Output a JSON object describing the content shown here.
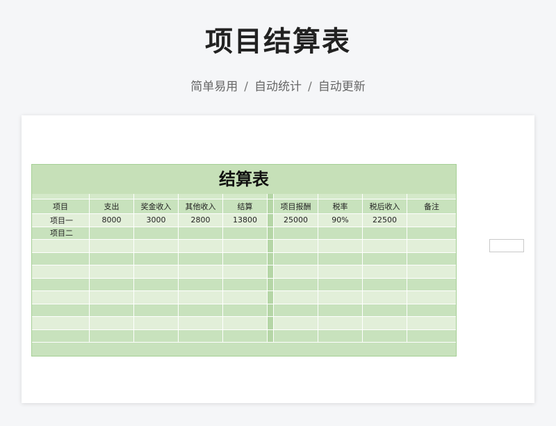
{
  "header": {
    "title": "项目结算表",
    "subtitle_parts": [
      "简单易用",
      "自动统计",
      "自动更新"
    ],
    "separator": "/"
  },
  "sheet": {
    "table_title": "结算表",
    "columns": [
      "项目",
      "支出",
      "奖金收入",
      "其他收入",
      "结算",
      "项目报酬",
      "税率",
      "税后收入",
      "备注"
    ],
    "rows": [
      [
        "项目一",
        "8000",
        "3000",
        "2800",
        "13800",
        "25000",
        "90%",
        "22500",
        ""
      ],
      [
        "项目二",
        "",
        "",
        "",
        "",
        "",
        "",
        "",
        ""
      ],
      [
        "",
        "",
        "",
        "",
        "",
        "",
        "",
        "",
        ""
      ],
      [
        "",
        "",
        "",
        "",
        "",
        "",
        "",
        "",
        ""
      ],
      [
        "",
        "",
        "",
        "",
        "",
        "",
        "",
        "",
        ""
      ],
      [
        "",
        "",
        "",
        "",
        "",
        "",
        "",
        "",
        ""
      ],
      [
        "",
        "",
        "",
        "",
        "",
        "",
        "",
        "",
        ""
      ],
      [
        "",
        "",
        "",
        "",
        "",
        "",
        "",
        "",
        ""
      ],
      [
        "",
        "",
        "",
        "",
        "",
        "",
        "",
        "",
        ""
      ],
      [
        "",
        "",
        "",
        "",
        "",
        "",
        "",
        "",
        ""
      ]
    ]
  },
  "colors": {
    "table_green": "#c8e2bd",
    "table_light_green": "#e2efd9",
    "border_green": "#a5cf95"
  }
}
